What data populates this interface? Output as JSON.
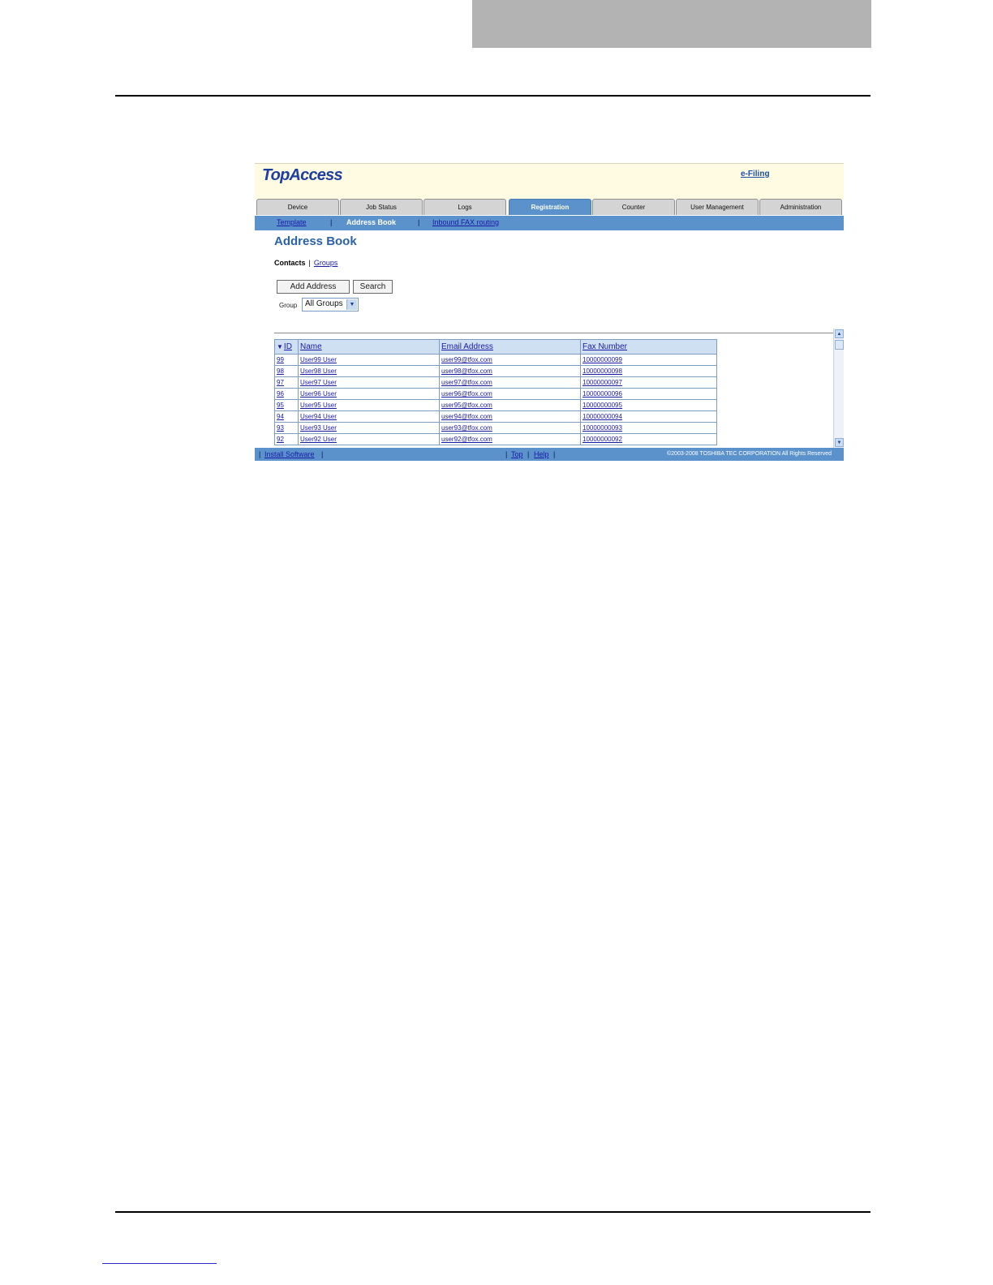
{
  "app": {
    "logo": "TopAccess",
    "efiling_link": "e-Filing"
  },
  "tabs": [
    {
      "label": "Device",
      "active": false
    },
    {
      "label": "Job Status",
      "active": false
    },
    {
      "label": "Logs",
      "active": false
    },
    {
      "label": "Registration",
      "active": true
    },
    {
      "label": "Counter",
      "active": false
    },
    {
      "label": "User Management",
      "active": false
    },
    {
      "label": "Administration",
      "active": false
    }
  ],
  "subnav": {
    "template": "Template",
    "address_book": "Address Book",
    "inbound_fax": "Inbound FAX routing",
    "separator": "|"
  },
  "page": {
    "title": "Address Book",
    "contacts": "Contacts",
    "separator": "|",
    "groups": "Groups",
    "add_address_button": "Add Address",
    "search_button": "Search",
    "group_label": "Group",
    "group_selected": "All Groups"
  },
  "table": {
    "headers": {
      "id": "ID",
      "name": "Name",
      "email": "Email Address",
      "fax": "Fax Number"
    },
    "rows": [
      {
        "id": "99",
        "name": "User99 User",
        "email": "user99@tfox.com",
        "fax": "10000000099"
      },
      {
        "id": "98",
        "name": "User98 User",
        "email": "user98@tfox.com",
        "fax": "10000000098"
      },
      {
        "id": "97",
        "name": "User97 User",
        "email": "user97@tfox.com",
        "fax": "10000000097"
      },
      {
        "id": "96",
        "name": "User96 User",
        "email": "user96@tfox.com",
        "fax": "10000000096"
      },
      {
        "id": "95",
        "name": "User95 User",
        "email": "user95@tfox.com",
        "fax": "10000000095"
      },
      {
        "id": "94",
        "name": "User94 User",
        "email": "user94@tfox.com",
        "fax": "10000000094"
      },
      {
        "id": "93",
        "name": "User93 User",
        "email": "user93@tfox.com",
        "fax": "10000000093"
      },
      {
        "id": "92",
        "name": "User92 User",
        "email": "user92@tfox.com",
        "fax": "10000000092"
      }
    ]
  },
  "footer": {
    "separator": "|",
    "install_software": "Install Software",
    "top": "Top",
    "help": "Help",
    "copyright": "©2003-2008 TOSHIBA TEC CORPORATION All Rights Reserved"
  },
  "colors": {
    "accent_blue": "#5b92cc",
    "header_bg": "#fffbe3",
    "link": "#1a1aa6"
  },
  "icons": {
    "sort": "sort-descending-icon",
    "dropdown": "chevron-down-icon",
    "scroll_up": "scroll-up-icon",
    "scroll_down": "scroll-down-icon"
  }
}
